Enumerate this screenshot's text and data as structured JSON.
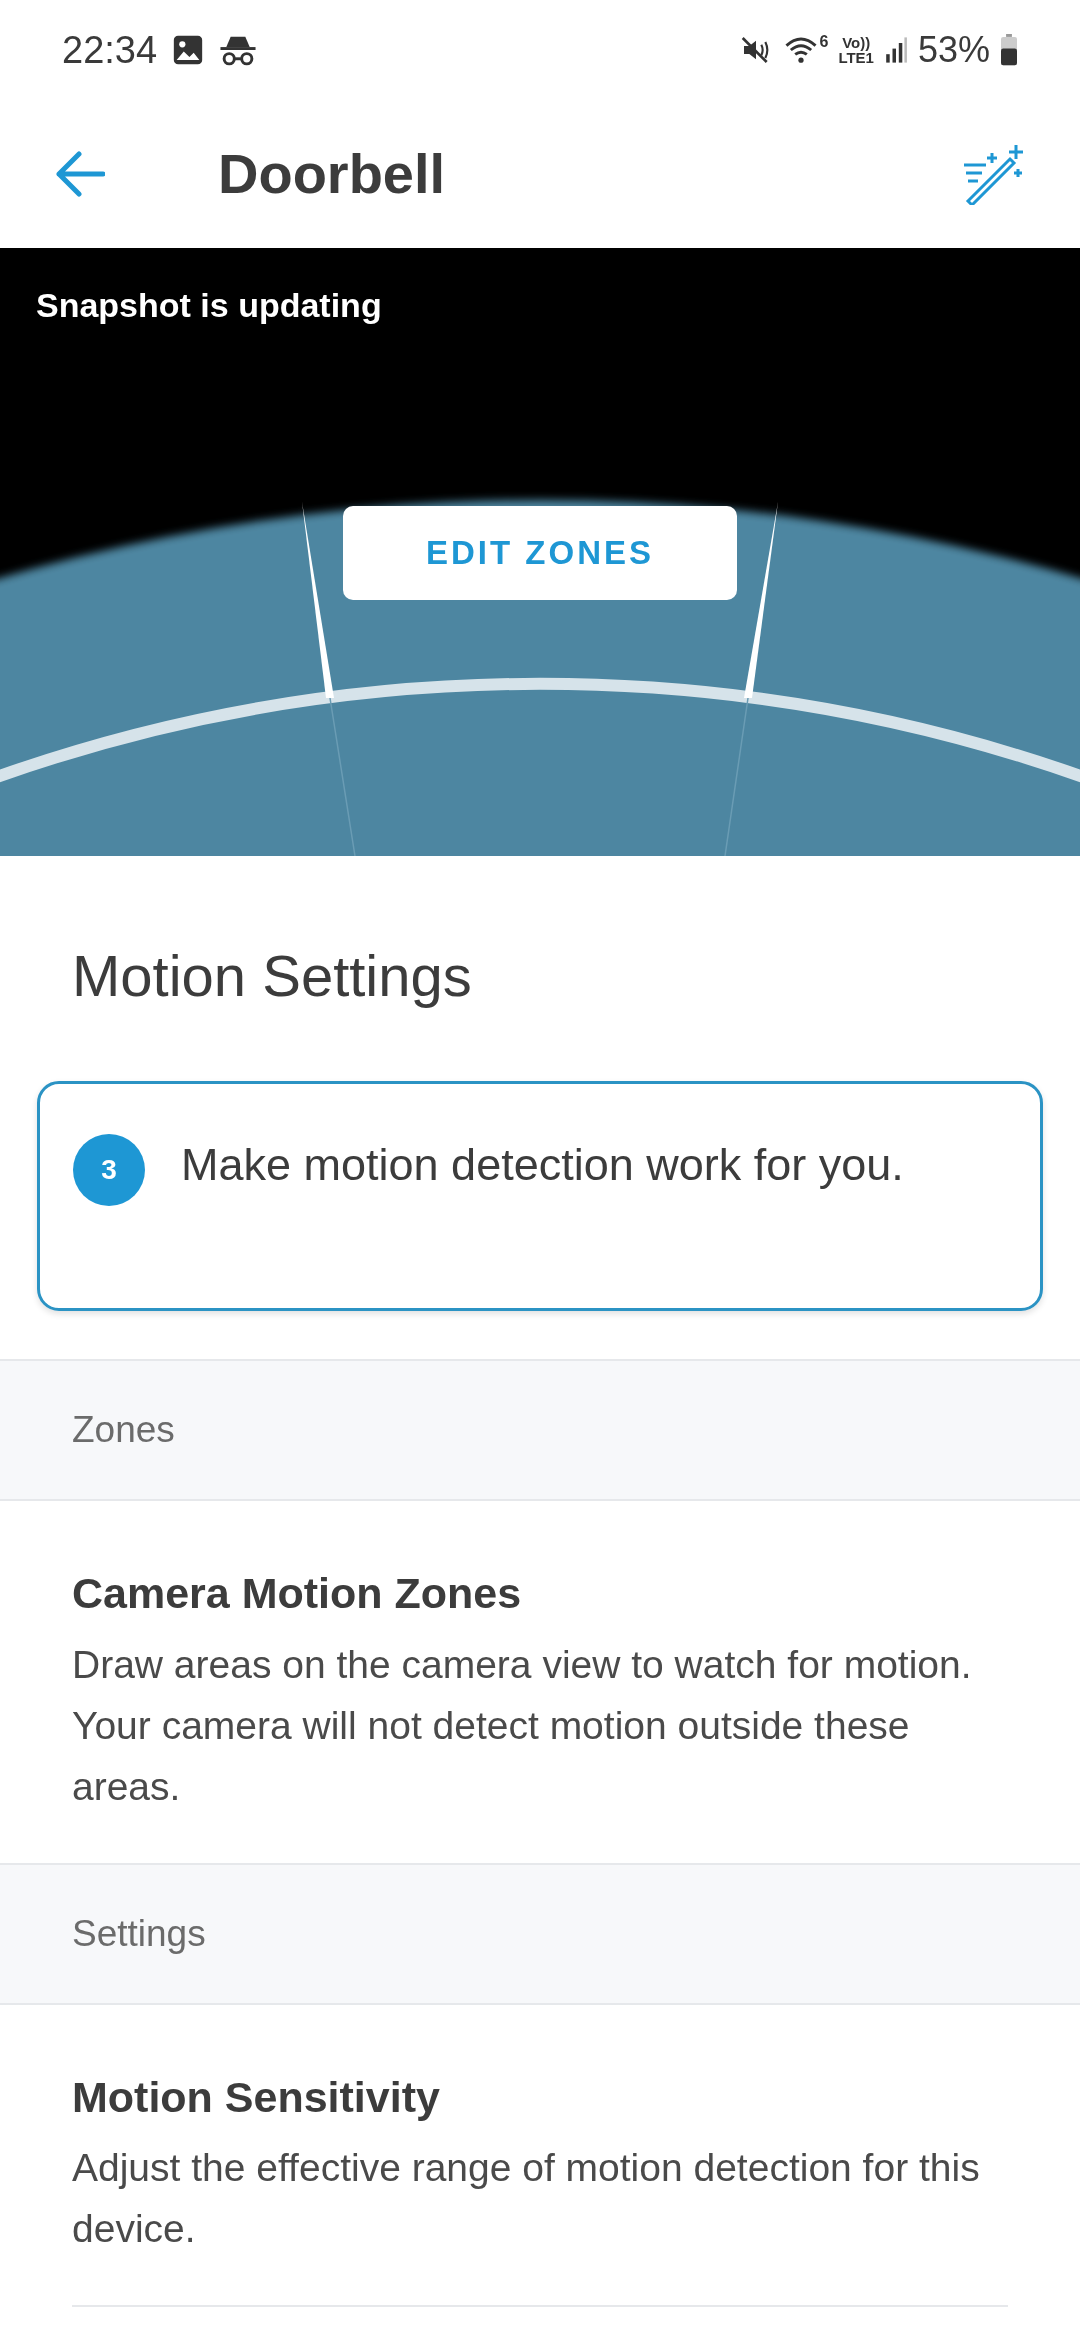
{
  "status_bar": {
    "time": "22:34",
    "wifi_label": "6",
    "network_labels": [
      "Vo))",
      "LTE1"
    ],
    "battery": "53%"
  },
  "header": {
    "title": "Doorbell"
  },
  "camera": {
    "status": "Snapshot is updating",
    "button": "EDIT ZONES"
  },
  "heading": "Motion Settings",
  "tip": {
    "step": "3",
    "text": "Make motion detection work for you."
  },
  "sections": [
    {
      "title": "Zones",
      "items": [
        {
          "title": "Camera Motion Zones",
          "description": "Draw areas on the camera view to watch for motion. Your camera will not detect motion outside these areas."
        }
      ]
    },
    {
      "title": "Settings",
      "items": [
        {
          "title": "Motion Sensitivity",
          "description": "Adjust the effective range of motion detection for this device."
        }
      ]
    }
  ]
}
